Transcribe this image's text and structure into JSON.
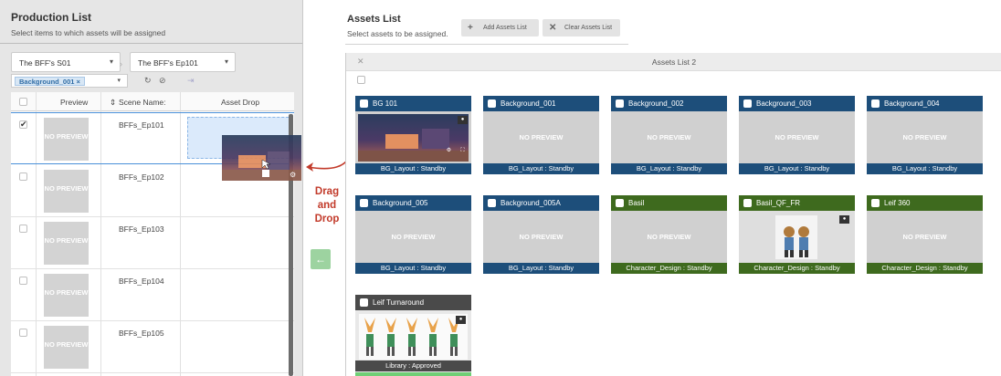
{
  "production": {
    "title": "Production List",
    "subtitle": "Select items to which assets will be assigned",
    "season": "The BFF's S01",
    "episode": "The BFF's Ep101",
    "filter_tag": "Background_001 ×",
    "columns": [
      "Preview",
      "Scene Name:",
      "Asset Drop"
    ],
    "rows": [
      {
        "preview": "NO PREVIEW",
        "scene": "BFFs_Ep101",
        "checked": true
      },
      {
        "preview": "NO PREVIEW",
        "scene": "BFFs_Ep102",
        "checked": false
      },
      {
        "preview": "NO PREVIEW",
        "scene": "BFFs_Ep103",
        "checked": false
      },
      {
        "preview": "NO PREVIEW",
        "scene": "BFFs_Ep104",
        "checked": false
      },
      {
        "preview": "NO PREVIEW",
        "scene": "BFFs_Ep105",
        "checked": false
      }
    ]
  },
  "drag_hint": {
    "line1": "Drag",
    "line2": "and",
    "line3": "Drop"
  },
  "assets": {
    "title": "Assets List",
    "subtitle": "Select assets to be assigned.",
    "add_label": "Add Assets List",
    "clear_label": "Clear Assets List",
    "panel_title": "Assets List 2",
    "cards": [
      {
        "name": "BG 101",
        "status": "BG_Layout : Standby",
        "preview": "",
        "theme": "blue"
      },
      {
        "name": "Background_001",
        "status": "BG_Layout : Standby",
        "preview": "NO PREVIEW",
        "theme": "blue"
      },
      {
        "name": "Background_002",
        "status": "BG_Layout : Standby",
        "preview": "NO PREVIEW",
        "theme": "blue"
      },
      {
        "name": "Background_003",
        "status": "BG_Layout : Standby",
        "preview": "NO PREVIEW",
        "theme": "blue"
      },
      {
        "name": "Background_004",
        "status": "BG_Layout : Standby",
        "preview": "NO PREVIEW",
        "theme": "blue"
      },
      {
        "name": "Background_005",
        "status": "BG_Layout : Standby",
        "preview": "NO PREVIEW",
        "theme": "blue"
      },
      {
        "name": "Background_005A",
        "status": "BG_Layout : Standby",
        "preview": "NO PREVIEW",
        "theme": "blue"
      },
      {
        "name": "Basil",
        "status": "Character_Design : Standby",
        "preview": "NO PREVIEW",
        "theme": "green"
      },
      {
        "name": "Basil_QF_FR",
        "status": "Character_Design : Standby",
        "preview": "",
        "theme": "green"
      },
      {
        "name": "Leif 360",
        "status": "Character_Design : Standby",
        "preview": "NO PREVIEW",
        "theme": "green"
      },
      {
        "name": "Leif Turnaround",
        "status": "Library : Approved",
        "preview": "",
        "theme": "gray"
      }
    ]
  },
  "colors": {
    "blue": "#1d4e7a",
    "green": "#3e6a1e",
    "gray": "#4a4a4a",
    "drag_text": "#c23a2a"
  }
}
